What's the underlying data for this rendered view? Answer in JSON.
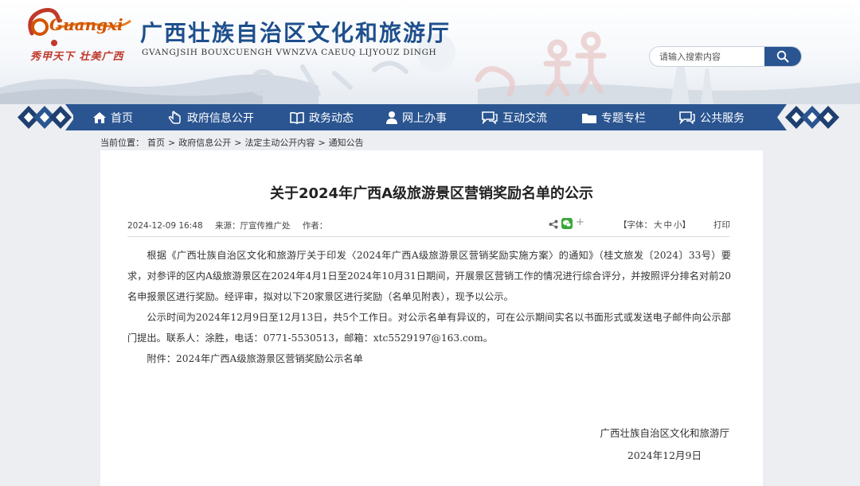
{
  "header": {
    "logo_text": "Guangxi",
    "slogan": "秀甲天下 壮美广西",
    "title": "广西壮族自治区文化和旅游厅",
    "subtitle": "GVANGJSIH BOUXCUENGH VWNZVA CAEUQ LIJYOUZ DINGH",
    "search": {
      "placeholder": "请输入搜索内容",
      "icon": "search-icon"
    }
  },
  "nav": {
    "items": [
      {
        "label": "首页",
        "icon": "home-icon"
      },
      {
        "label": "政府信息公开",
        "icon": "pointer-icon"
      },
      {
        "label": "政务动态",
        "icon": "book-icon"
      },
      {
        "label": "网上办事",
        "icon": "user-icon"
      },
      {
        "label": "互动交流",
        "icon": "chat-icon"
      },
      {
        "label": "专题专栏",
        "icon": "folder-icon"
      },
      {
        "label": "公共服务",
        "icon": "service-icon"
      }
    ],
    "colors": {
      "band": "#2a5591",
      "pattern": "#1e3f70"
    }
  },
  "breadcrumb": {
    "prefix": "当前位置：",
    "items": [
      "首页",
      "政府信息公开",
      "法定主动公开内容",
      "通知公告"
    ],
    "separator": ">"
  },
  "article": {
    "title": "关于2024年广西A级旅游景区营销奖励名单的公示",
    "meta": {
      "date": "2024-12-09 16:48",
      "source": "来源：厅宣传推广处",
      "author": "作者：",
      "font_label": "【字体：",
      "font_sizes": [
        "大",
        "中",
        "小"
      ],
      "font_close": "】",
      "print": "打印"
    },
    "paragraphs": [
      "根据《广西壮族自治区文化和旅游厅关于印发〈2024年广西A级旅游景区营销奖励实施方案〉的通知》（桂文旅发〔2024〕33号）要求，对参评的区内A级旅游景区在2024年4月1日至2024年10月31日期间，开展景区营销工作的情况进行综合评分，并按照评分排名对前20名申报景区进行奖励。经评审，拟对以下20家景区进行奖励（名单见附表），现予以公示。",
      "公示时间为2024年12月9日至12月13日，共5个工作日。对公示名单有异议的，可在公示期间实名以书面形式或发送电子邮件向公示部门提出。联系人：涂胜，电话：0771-5530513，邮箱：xtc5529197@163.com。",
      "附件：2024年广西A级旅游景区营销奖励公示名单"
    ],
    "signature": "广西壮族自治区文化和旅游厅",
    "sign_date": "2024年12月9日"
  }
}
